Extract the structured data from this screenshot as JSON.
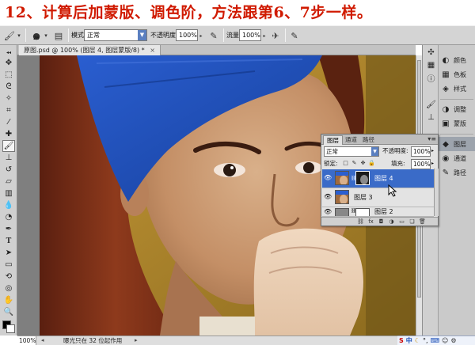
{
  "caption": "12、计算后加蒙版、调色阶，方法跟第6、7步一样。",
  "options_bar": {
    "mode_label": "模式:",
    "mode_value": "正常",
    "opacity_label": "不透明度:",
    "opacity_value": "100%",
    "flow_label": "流量:",
    "flow_value": "100%",
    "brush_size": "26"
  },
  "document": {
    "tab_title": "原图.psd @ 100% (图层 4, 图层蒙版/8) *",
    "close_glyph": "×"
  },
  "status_bar": {
    "zoom": "100%",
    "info": "曝光只在 32 位起作用"
  },
  "layers_panel": {
    "tabs": [
      "图层",
      "通道",
      "路径"
    ],
    "blend_mode": "正常",
    "opacity_label": "不透明度:",
    "opacity_value": "100%",
    "lock_label": "锁定:",
    "fill_label": "填充:",
    "fill_value": "100%",
    "layers": [
      {
        "name": "图层 4",
        "selected": true
      },
      {
        "name": "图层 3",
        "selected": false
      },
      {
        "name": "图层 2",
        "selected": false
      }
    ]
  },
  "dock": {
    "items": [
      {
        "label": "颜色",
        "icon": "palette-icon"
      },
      {
        "label": "色板",
        "icon": "swatches-icon"
      },
      {
        "label": "样式",
        "icon": "styles-icon"
      },
      {
        "label": "调整",
        "icon": "adjustments-icon"
      },
      {
        "label": "蒙版",
        "icon": "masks-icon"
      },
      {
        "label": "图层",
        "icon": "layers-icon"
      },
      {
        "label": "通道",
        "icon": "channels-icon"
      },
      {
        "label": "路径",
        "icon": "paths-icon"
      }
    ]
  },
  "tray": {
    "lang": "中"
  },
  "colors": {
    "caption": "#d01a00",
    "selection": "#3a6bc8",
    "headband": "#1f4fb6",
    "hair": "#7a2c16",
    "background_wall": "#b08a2a"
  }
}
